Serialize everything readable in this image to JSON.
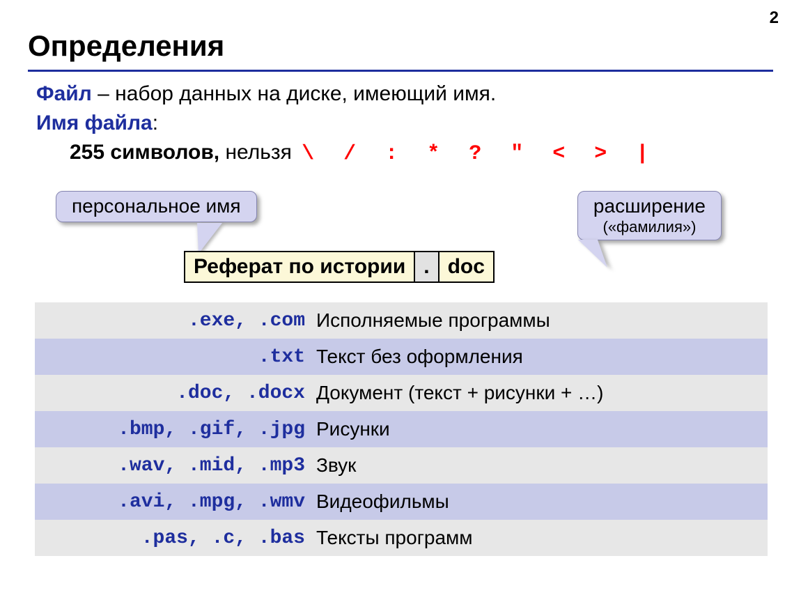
{
  "page_number": "2",
  "heading": "Определения",
  "def": {
    "term1": "Файл",
    "text1": " – набор данных на диске, имеющий имя.",
    "term2": "Имя файла",
    "colon": ":",
    "limit_bold": "255 символов,",
    "limit_rest": " нельзя ",
    "forbidden": "\\ / : * ? \" < > |"
  },
  "callouts": {
    "left": "персональное имя",
    "right": "расширение",
    "right_sub": "(«фамилия»)"
  },
  "filebox": {
    "name": "Реферат по истории",
    "dot": ".",
    "ext": "doc"
  },
  "extensions": [
    {
      "ext": ".exe, .com",
      "desc": "Исполняемые программы"
    },
    {
      "ext": ".txt",
      "desc": "Текст без оформления"
    },
    {
      "ext": ".doc, .docx",
      "desc": "Документ (текст + рисунки + …)"
    },
    {
      "ext": ".bmp, .gif, .jpg",
      "desc": "Рисунки"
    },
    {
      "ext": ".wav, .mid, .mp3",
      "desc": "Звук"
    },
    {
      "ext": ".avi, .mpg, .wmv",
      "desc": "Видеофильмы"
    },
    {
      "ext": ".pas, .c, .bas",
      "desc": "Тексты программ"
    }
  ]
}
